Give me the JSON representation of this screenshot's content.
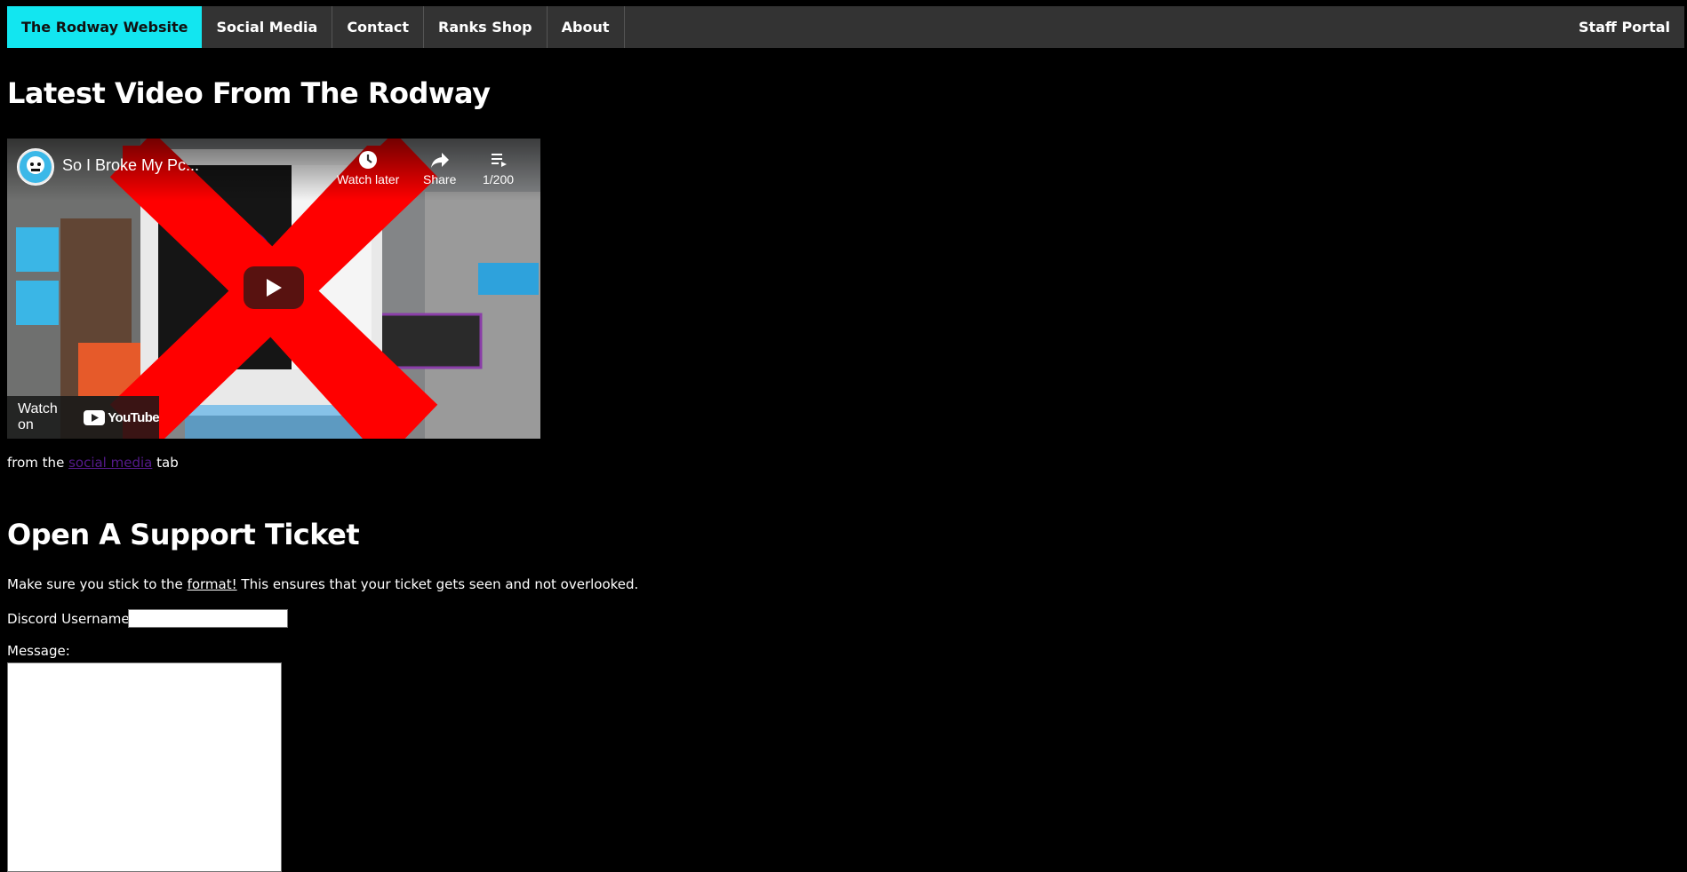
{
  "nav": {
    "items": [
      {
        "label": "The Rodway Website",
        "active": true
      },
      {
        "label": "Social Media",
        "active": false
      },
      {
        "label": "Contact",
        "active": false
      },
      {
        "label": "Ranks Shop",
        "active": false
      },
      {
        "label": "About",
        "active": false
      }
    ],
    "right_item": "Staff Portal",
    "accent_color": "#12e6f0"
  },
  "latest_video": {
    "heading": "Latest Video From The Rodway",
    "title": "So I Broke My Pc...",
    "watch_later": "Watch later",
    "share": "Share",
    "playlist_count": "1/200",
    "watch_on": "Watch on",
    "youtube_label": "YouTube",
    "from_prefix": "from the",
    "from_link": "social media",
    "from_suffix": "tab"
  },
  "ticket": {
    "heading": "Open A Support Ticket",
    "intro_prefix": "Make sure you stick to the",
    "intro_link": "format!",
    "intro_suffix": "This ensures that your ticket gets seen and not overlooked.",
    "discord_label": "Discord Username:",
    "discord_value": "",
    "message_label": "Message:",
    "message_value": ""
  }
}
